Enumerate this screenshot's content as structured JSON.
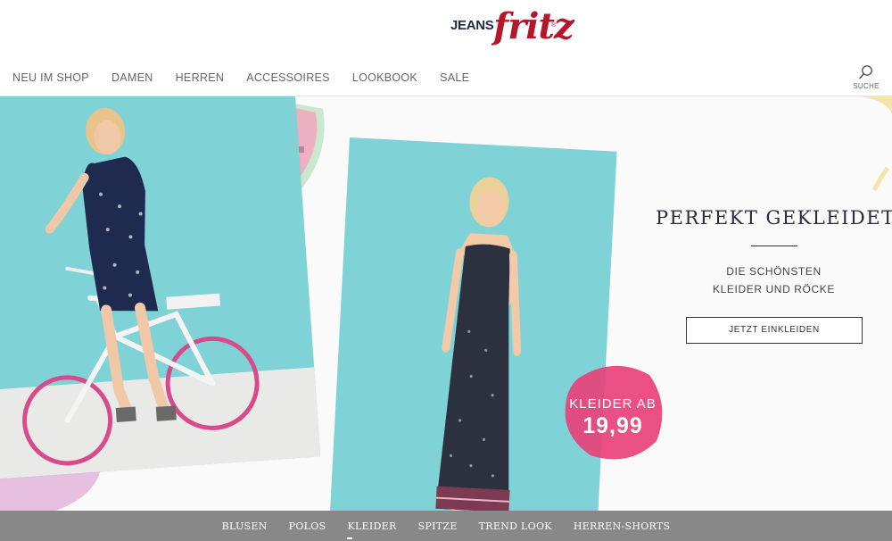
{
  "brand": {
    "jeans": "JEANS",
    "fritz": "fritz",
    "reg": "®"
  },
  "nav": {
    "items": [
      {
        "label": "NEU IM SHOP"
      },
      {
        "label": "DAMEN"
      },
      {
        "label": "HERREN"
      },
      {
        "label": "ACCESSOIRES"
      },
      {
        "label": "LOOKBOOK"
      },
      {
        "label": "SALE"
      }
    ]
  },
  "search": {
    "label": "SUCHE",
    "icon": "search-icon"
  },
  "promo": {
    "title": "PERFEKT GEKLEIDET",
    "subtitle_line1": "DIE SCHÖNSTEN",
    "subtitle_line2": "KLEIDER UND RÖCKE",
    "button": "JETZT EINKLEIDEN"
  },
  "badge": {
    "line1": "KLEIDER AB",
    "price": "19,99"
  },
  "bottom_nav": {
    "items": [
      {
        "label": "BLUSEN"
      },
      {
        "label": "POLOS"
      },
      {
        "label": "KLEIDER",
        "active": true
      },
      {
        "label": "SPITZE"
      },
      {
        "label": "TREND LOOK"
      },
      {
        "label": "HERREN-SHORTS"
      }
    ]
  },
  "colors": {
    "brand_red": "#b5162b",
    "brand_navy": "#1f2a44",
    "turquoise": "#7fd3d6",
    "badge_pink": "#e8417a",
    "bottom_bar": "#6e6e6e"
  }
}
